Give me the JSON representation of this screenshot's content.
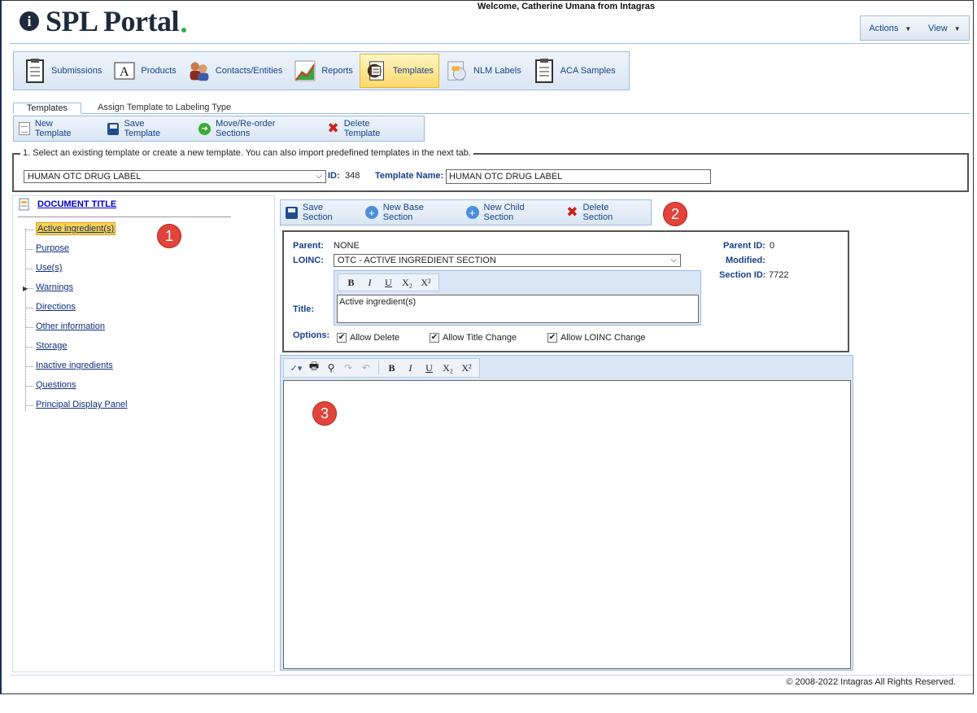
{
  "header": {
    "welcome": "Welcome, Catherine Umana from Intagras",
    "logo_text": "SPL Portal",
    "actions_label": "Actions",
    "view_label": "View"
  },
  "main_toolbar": {
    "items": [
      {
        "label": "Submissions",
        "icon": "clipboard-icon"
      },
      {
        "label": "Products",
        "icon": "document-a-icon"
      },
      {
        "label": "Contacts/Entities",
        "icon": "people-icon"
      },
      {
        "label": "Reports",
        "icon": "chart-icon"
      },
      {
        "label": "Templates",
        "icon": "templates-icon",
        "active": true
      },
      {
        "label": "NLM Labels",
        "icon": "labels-icon"
      },
      {
        "label": "ACA Samples",
        "icon": "clipboard-icon"
      }
    ]
  },
  "subtabs": {
    "templates": "Templates",
    "assign": "Assign Template to Labeling Type"
  },
  "template_toolbar": {
    "new": "New Template",
    "save": "Save Template",
    "move": "Move/Re-order Sections",
    "delete": "Delete Template"
  },
  "selector": {
    "legend": "1. Select an existing template or create a new template. You can also import predefined templates in the next tab.",
    "selected": "HUMAN OTC DRUG LABEL",
    "id_label": "ID:",
    "id_value": "348",
    "name_label": "Template Name:",
    "name_value": "HUMAN OTC DRUG LABEL"
  },
  "tree": {
    "doc_title": "DOCUMENT TITLE",
    "items": [
      "Active ingredient(s)",
      "Purpose",
      "Use(s)",
      "Warnings",
      "Directions",
      "Other information",
      "Storage",
      "Inactive ingredients",
      "Questions",
      "Principal Display Panel"
    ]
  },
  "section_toolbar": {
    "save": "Save Section",
    "new_base": "New Base Section",
    "new_child": "New Child Section",
    "delete": "Delete Section"
  },
  "section": {
    "parent_label": "Parent:",
    "parent_value": "NONE",
    "loinc_label": "LOINC:",
    "loinc_value": "OTC - ACTIVE INGREDIENT SECTION",
    "title_label": "Title:",
    "title_value": "Active ingredient(s)",
    "options_label": "Options:",
    "opt_delete": "Allow Delete",
    "opt_title": "Allow Title Change",
    "opt_loinc": "Allow LOINC Change",
    "parent_id_label": "Parent ID:",
    "parent_id_value": "0",
    "modified_label": "Modified:",
    "section_id_label": "Section ID:",
    "section_id_value": "7722"
  },
  "format": {
    "bold": "B",
    "italic": "I",
    "underline": "U",
    "subscript": "X₂",
    "superscript": "X²"
  },
  "badges": [
    "1",
    "2",
    "3"
  ],
  "footer": "© 2008-2022 Intagras All Rights Reserved."
}
